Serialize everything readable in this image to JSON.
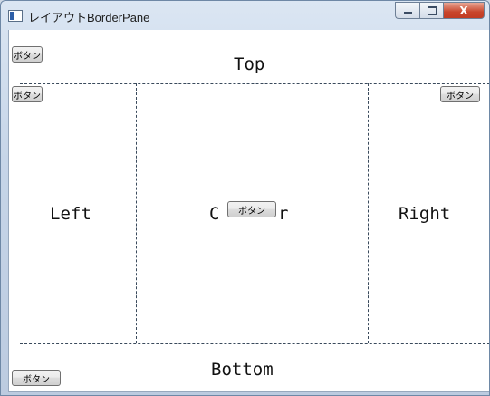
{
  "window": {
    "title": "レイアウトBorderPane",
    "controls": {
      "minimize": "–",
      "maximize": "□",
      "close": "X"
    }
  },
  "pane": {
    "top": {
      "label": "Top",
      "button_label": "ボタン"
    },
    "left": {
      "label": "Left",
      "button_label": "ボタン"
    },
    "center": {
      "label_start": "C",
      "label_end": "r",
      "button_label": "ボタン"
    },
    "right": {
      "label": "Right",
      "button_label": "ボタン"
    },
    "bottom": {
      "label": "Bottom",
      "button_label": "ボタン"
    }
  },
  "colors": {
    "frame": "#c6d5e8",
    "close_button": "#c8452b",
    "client_bg": "#ffffff",
    "divider": "#3a4a5c"
  }
}
